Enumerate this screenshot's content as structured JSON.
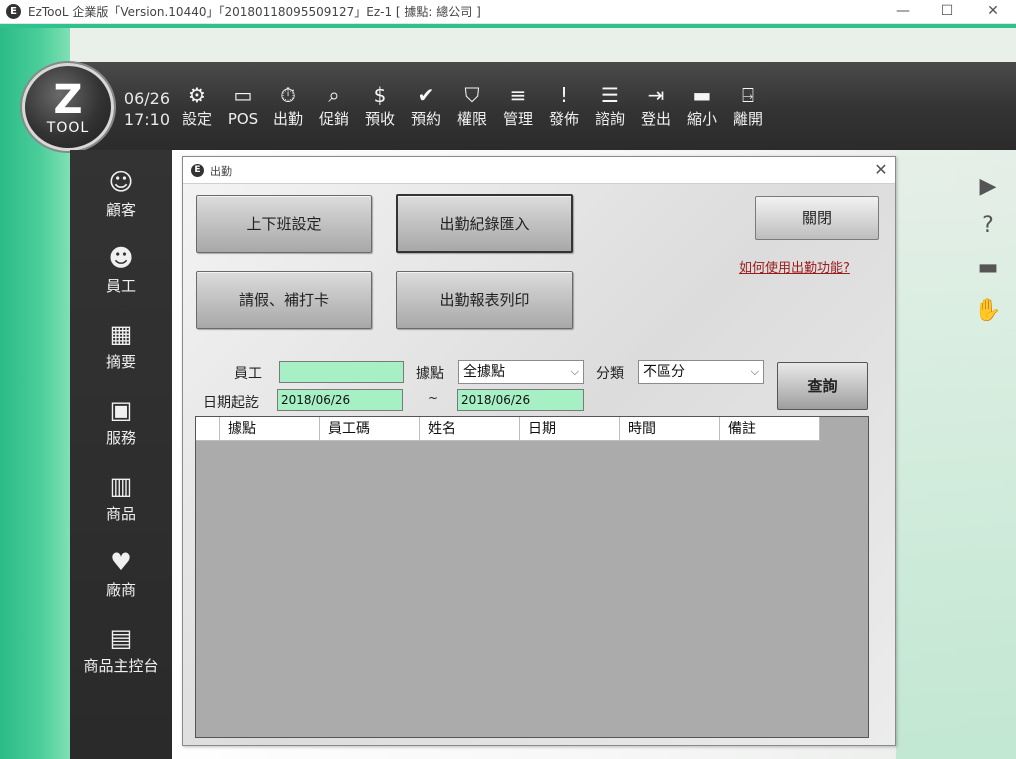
{
  "window": {
    "title": "EzTooL 企業版「Version.10440」「20180118095509127」Ez-1 [ 據點: 總公司 ]",
    "app_icon": "E"
  },
  "header": {
    "logo_mark": "Z",
    "logo_text": "TOOL",
    "date": "06/26",
    "time": "17:10"
  },
  "toolbar": {
    "items": [
      {
        "label": "設定",
        "icon": "gear-icon",
        "glyph": "⚙"
      },
      {
        "label": "POS",
        "icon": "monitor-icon",
        "glyph": "▭"
      },
      {
        "label": "出勤",
        "icon": "stopwatch-icon",
        "glyph": "⏱"
      },
      {
        "label": "促銷",
        "icon": "magnifier-coin-icon",
        "glyph": "⌕"
      },
      {
        "label": "預收",
        "icon": "coins-icon",
        "glyph": "$"
      },
      {
        "label": "預約",
        "icon": "calendar-check-icon",
        "glyph": "✔"
      },
      {
        "label": "權限",
        "icon": "shield-icon",
        "glyph": "⛉"
      },
      {
        "label": "管理",
        "icon": "stack-icon",
        "glyph": "≡"
      },
      {
        "label": "發佈",
        "icon": "announcement-icon",
        "glyph": "!"
      },
      {
        "label": "諮詢",
        "icon": "chat-icon",
        "glyph": "☰"
      },
      {
        "label": "登出",
        "icon": "logout-icon",
        "glyph": "⇥"
      },
      {
        "label": "縮小",
        "icon": "minimize-icon",
        "glyph": "▬"
      },
      {
        "label": "離開",
        "icon": "exit-door-icon",
        "glyph": "⍈"
      }
    ]
  },
  "sidebar": {
    "items": [
      {
        "label": "顧客",
        "icon": "customer-icon",
        "glyph": "☺"
      },
      {
        "label": "員工",
        "icon": "employees-icon",
        "glyph": "☻"
      },
      {
        "label": "摘要",
        "icon": "summary-icon",
        "glyph": "▦"
      },
      {
        "label": "服務",
        "icon": "toolbox-icon",
        "glyph": "▣"
      },
      {
        "label": "商品",
        "icon": "products-icon",
        "glyph": "▥"
      },
      {
        "label": "廠商",
        "icon": "vendor-icon",
        "glyph": "♥"
      },
      {
        "label": "商品主控台",
        "icon": "product-console-icon",
        "glyph": "▤"
      }
    ]
  },
  "right_icons": [
    {
      "icon": "video-icon",
      "glyph": "▶"
    },
    {
      "icon": "help-icon",
      "glyph": "?"
    },
    {
      "icon": "cards-icon",
      "glyph": "▬"
    },
    {
      "icon": "hand-icon",
      "glyph": "✋"
    }
  ],
  "dialog": {
    "title": "出勤",
    "close_glyph": "✕",
    "buttons": {
      "shift_settings": "上下班設定",
      "import_records": "出勤紀錄匯入",
      "leave_punch": "請假、補打卡",
      "print_report": "出勤報表列印",
      "close": "關閉",
      "query": "查詢"
    },
    "help_link": "如何使用出勤功能?",
    "filters": {
      "employee_label": "員工",
      "employee_value": "",
      "location_label": "據點",
      "location_value": "全據點",
      "category_label": "分類",
      "category_value": "不區分",
      "date_label": "日期起訖",
      "date_from": "2018/06/26",
      "date_sep": "~",
      "date_to": "2018/06/26"
    },
    "grid": {
      "columns": [
        "據點",
        "員工碼",
        "姓名",
        "日期",
        "時間",
        "備註"
      ],
      "rows": []
    }
  }
}
